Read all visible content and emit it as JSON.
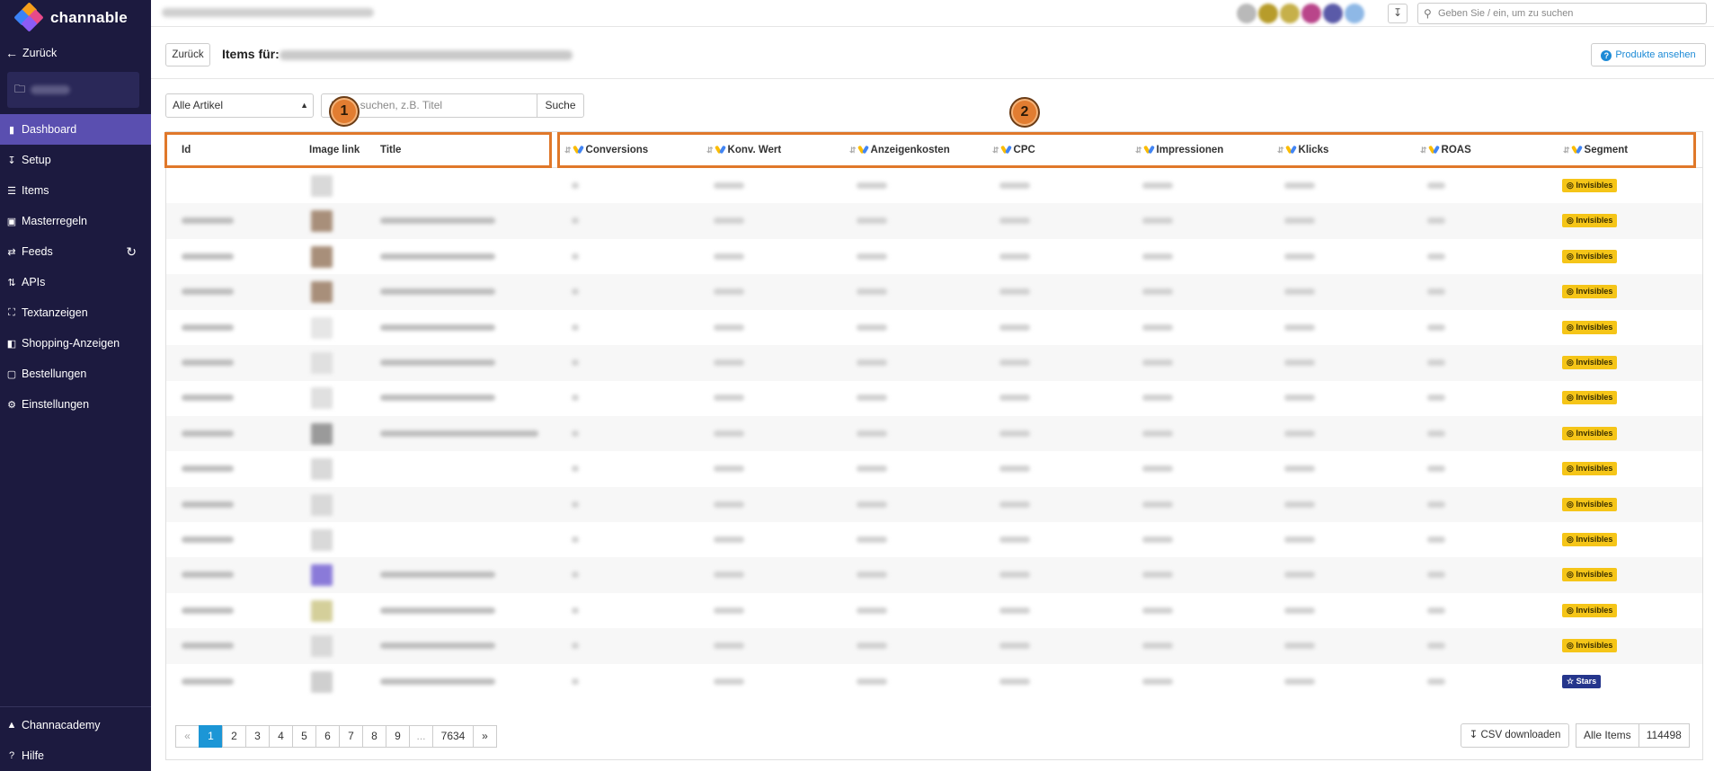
{
  "sidebar": {
    "brand": "channable",
    "back": "Zurück",
    "nav": [
      {
        "label": "Dashboard",
        "icon": "bar-chart-icon"
      },
      {
        "label": "Setup",
        "icon": "download-tray-icon"
      },
      {
        "label": "Items",
        "icon": "list-icon"
      },
      {
        "label": "Masterregeln",
        "icon": "clipboard-icon"
      },
      {
        "label": "Feeds",
        "icon": "arrows-exchange-icon"
      },
      {
        "label": "APIs",
        "icon": "sort-arrows-icon"
      },
      {
        "label": "Textanzeigen",
        "icon": "expand-icon"
      },
      {
        "label": "Shopping-Anzeigen",
        "icon": "shopping-bag-icon"
      },
      {
        "label": "Bestellungen",
        "icon": "box-icon"
      },
      {
        "label": "Einstellungen",
        "icon": "gear-icon"
      }
    ],
    "bottom": [
      {
        "label": "Channacademy",
        "icon": "graduation-cap-icon"
      },
      {
        "label": "Hilfe",
        "icon": "help-circle-icon"
      }
    ]
  },
  "topbar": {
    "search_placeholder": "Geben Sie / ein, um zu suchen"
  },
  "header": {
    "back_button": "Zurück",
    "title": "Items für:",
    "products_button": "Produkte ansehen"
  },
  "filters": {
    "select_value": "Alle Artikel",
    "search_placeholder": "Items suchen, z.B. Titel",
    "search_button": "Suche"
  },
  "callouts": [
    "1",
    "2"
  ],
  "table": {
    "columns": [
      "Id",
      "Image link",
      "Title",
      "Conversions",
      "Konv. Wert",
      "Anzeigenkosten",
      "CPC",
      "Impressionen",
      "Klicks",
      "ROAS",
      "Segment"
    ],
    "segments": [
      "Invisibles",
      "Invisibles",
      "Invisibles",
      "Invisibles",
      "Invisibles",
      "Invisibles",
      "Invisibles",
      "Invisibles",
      "Invisibles",
      "Invisibles",
      "Invisibles",
      "Invisibles",
      "Invisibles",
      "Invisibles",
      "Stars"
    ]
  },
  "pagination": {
    "prev": "«",
    "pages": [
      "1",
      "2",
      "3",
      "4",
      "5",
      "6",
      "7",
      "8",
      "9",
      "...",
      "7634"
    ],
    "next": "»",
    "active": "1"
  },
  "footer": {
    "csv_button": "CSV downloaden",
    "all_items_label": "Alle Items",
    "all_items_count": "114498"
  },
  "colors": {
    "sidebar_bg": "#1c1a3f",
    "active_nav": "#5a4fb0",
    "highlight": "#e0782a",
    "invisibles_tag": "#f5c518",
    "stars_tag": "#25368c",
    "link_blue": "#1c8ad6"
  }
}
